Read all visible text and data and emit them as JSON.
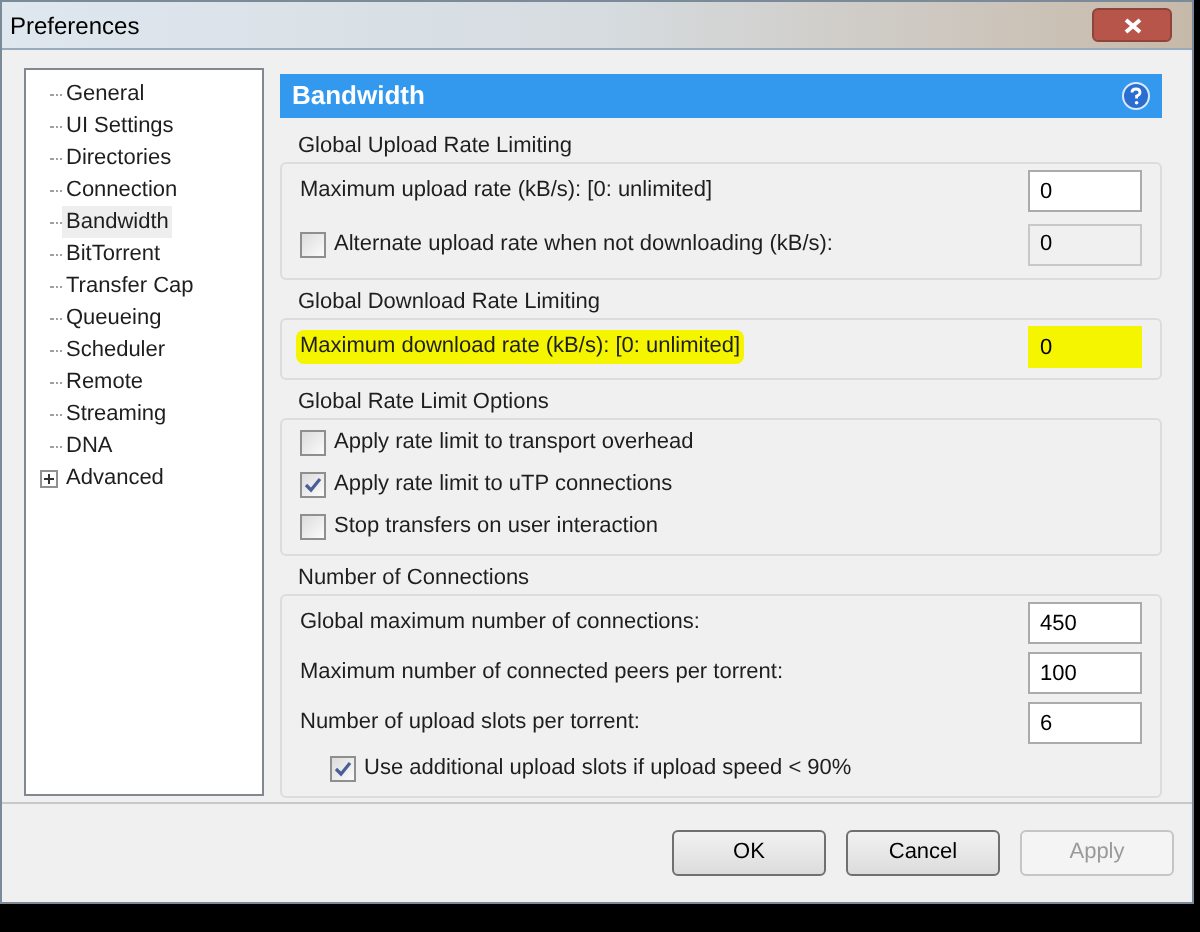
{
  "window": {
    "title": "Preferences"
  },
  "sidebar": {
    "items": [
      {
        "label": "General",
        "selected": false,
        "kind": "leaf"
      },
      {
        "label": "UI Settings",
        "selected": false,
        "kind": "leaf"
      },
      {
        "label": "Directories",
        "selected": false,
        "kind": "leaf"
      },
      {
        "label": "Connection",
        "selected": false,
        "kind": "leaf"
      },
      {
        "label": "Bandwidth",
        "selected": true,
        "kind": "leaf"
      },
      {
        "label": "BitTorrent",
        "selected": false,
        "kind": "leaf"
      },
      {
        "label": "Transfer Cap",
        "selected": false,
        "kind": "leaf"
      },
      {
        "label": "Queueing",
        "selected": false,
        "kind": "leaf"
      },
      {
        "label": "Scheduler",
        "selected": false,
        "kind": "leaf"
      },
      {
        "label": "Remote",
        "selected": false,
        "kind": "leaf"
      },
      {
        "label": "Streaming",
        "selected": false,
        "kind": "leaf"
      },
      {
        "label": "DNA",
        "selected": false,
        "kind": "leaf"
      },
      {
        "label": "Advanced",
        "selected": false,
        "kind": "folder",
        "expanded": false
      }
    ]
  },
  "header": {
    "title": "Bandwidth"
  },
  "groups": [
    {
      "title": "Global Upload Rate Limiting",
      "rows": [
        {
          "kind": "field",
          "label": "Maximum upload rate (kB/s): [0: unlimited]",
          "value": "0",
          "disabled": false,
          "highlighted": false
        },
        {
          "kind": "checkbox_field",
          "label": "Alternate upload rate when not downloading (kB/s):",
          "checked": false,
          "value": "0",
          "disabled": true,
          "highlighted": false
        }
      ]
    },
    {
      "title": "Global Download Rate Limiting",
      "rows": [
        {
          "kind": "field",
          "label": "Maximum download rate (kB/s): [0: unlimited]",
          "value": "0",
          "disabled": false,
          "highlighted": true
        }
      ]
    },
    {
      "title": "Global Rate Limit Options",
      "rows": [
        {
          "kind": "checkbox",
          "label": "Apply rate limit to transport overhead",
          "checked": false,
          "indented": false
        },
        {
          "kind": "checkbox",
          "label": "Apply rate limit to uTP connections",
          "checked": true,
          "indented": false
        },
        {
          "kind": "checkbox",
          "label": "Stop transfers on user interaction",
          "checked": false,
          "indented": false
        }
      ]
    },
    {
      "title": "Number of Connections",
      "rows": [
        {
          "kind": "field",
          "label": "Global maximum number of connections:",
          "value": "450",
          "disabled": false,
          "highlighted": false
        },
        {
          "kind": "field",
          "label": "Maximum number of connected peers per torrent:",
          "value": "100",
          "disabled": false,
          "highlighted": false
        },
        {
          "kind": "field",
          "label": "Number of upload slots per torrent:",
          "value": "6",
          "disabled": false,
          "highlighted": false
        },
        {
          "kind": "checkbox",
          "label": "Use additional upload slots if upload speed < 90%",
          "checked": true,
          "indented": true
        }
      ]
    }
  ],
  "buttons": [
    {
      "label": "OK",
      "disabled": false
    },
    {
      "label": "Cancel",
      "disabled": false
    },
    {
      "label": "Apply",
      "disabled": true
    }
  ]
}
